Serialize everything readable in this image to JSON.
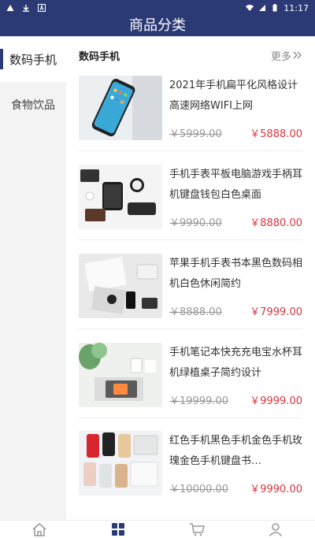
{
  "status": {
    "time": "11:17"
  },
  "header": {
    "title": "商品分类"
  },
  "sidebar": {
    "items": [
      {
        "label": "数码手机",
        "active": true
      },
      {
        "label": "食物饮品",
        "active": false
      }
    ]
  },
  "section": {
    "title": "数码手机",
    "more": "更多"
  },
  "products": [
    {
      "title": "2021年手机扁平化风格设计高速网络WIFI上网",
      "old_price": "￥5999.00",
      "price": "￥5888.00"
    },
    {
      "title": "手机手表平板电脑游戏手柄耳机键盘钱包白色桌面",
      "old_price": "￥9990.00",
      "price": "￥8880.00"
    },
    {
      "title": "苹果手机手表书本黑色数码相机白色休闲简约",
      "old_price": "￥8888.00",
      "price": "￥7999.00"
    },
    {
      "title": "手机笔记本快充充电宝水杯耳机绿植桌子简约设计",
      "old_price": "￥19999.00",
      "price": "￥9999.00"
    },
    {
      "title": "红色手机黑色手机金色手机玫瑰金色手机键盘书…",
      "old_price": "￥10000.00",
      "price": "￥9990.00"
    }
  ],
  "tabbar": {
    "items": [
      {
        "icon": "home-icon"
      },
      {
        "icon": "category-grid-icon",
        "active": true
      },
      {
        "icon": "cart-icon"
      },
      {
        "icon": "user-icon"
      }
    ],
    "active_color": "#2b3a75",
    "inactive_color": "#999999"
  }
}
